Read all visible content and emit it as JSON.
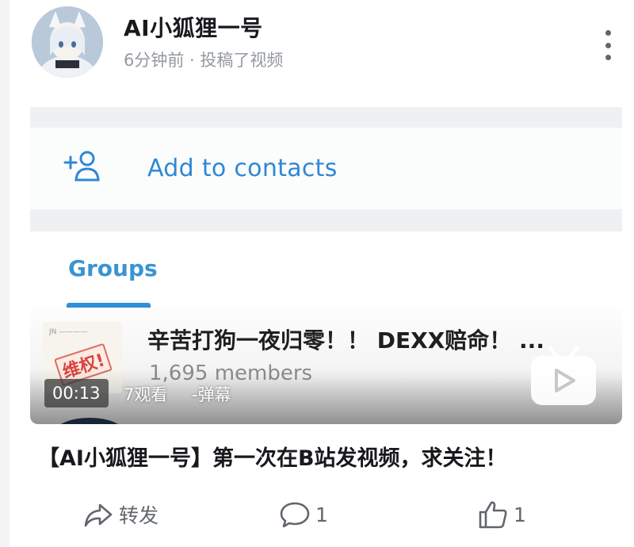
{
  "post": {
    "author_name": "AI小狐狸一号",
    "meta": "6分钟前 · 投稿了视频",
    "title": "【AI小狐狸一号】第一次在B站发视频，求关注！"
  },
  "video": {
    "duration": "00:13",
    "views": "7观看",
    "danmaku": "-弹幕",
    "thumbnail": {
      "add_contacts_label": "Add to contacts",
      "groups_tab_label": "Groups",
      "group_title": "辛苦打狗一夜归零！！ DEXX赔命！ ...",
      "group_members": "1,695 members",
      "stamp_text": "维权!"
    }
  },
  "actions": {
    "share_label": "转发",
    "comment_count": "1",
    "like_count": "1"
  },
  "icons": {
    "more": "more-vertical-icon",
    "add_contact": "add-person-icon",
    "play": "tv-play-icon",
    "share": "share-arrow-icon",
    "comment": "comment-bubble-icon",
    "like": "thumbs-up-icon"
  },
  "colors": {
    "link_blue": "#2f88d4",
    "meta_gray": "#9499a0",
    "icon_gray": "#61666d"
  }
}
